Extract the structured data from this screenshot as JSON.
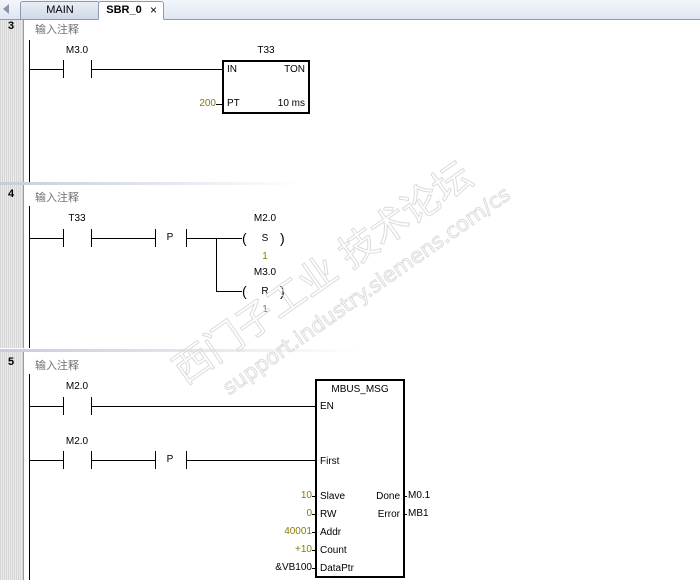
{
  "tabs": [
    {
      "label": "MAIN",
      "active": false
    },
    {
      "label": "SBR_0",
      "active": true,
      "close": "×"
    }
  ],
  "networks": [
    {
      "number": "3",
      "comment": "输入注释",
      "contact_label": "M3.0",
      "timer": {
        "name": "T33",
        "in": "IN",
        "type": "TON",
        "pt_label": "PT",
        "pt_value": "200",
        "resolution": "10 ms"
      }
    },
    {
      "number": "4",
      "comment": "输入注释",
      "contact_label": "T33",
      "edge": "P",
      "coils": [
        {
          "operand": "M2.0",
          "symbol": "S",
          "count": "1"
        },
        {
          "operand": "M3.0",
          "symbol": "R",
          "count": "1"
        }
      ]
    },
    {
      "number": "5",
      "comment": "输入注释",
      "contacts": [
        "M2.0",
        "M2.0"
      ],
      "edge": "P",
      "block": {
        "name": "MBUS_MSG",
        "en": "EN",
        "first": "First",
        "inputs": [
          {
            "param": "Slave",
            "value": "10"
          },
          {
            "param": "RW",
            "value": "0"
          },
          {
            "param": "Addr",
            "value": "40001"
          },
          {
            "param": "Count",
            "value": "+10"
          },
          {
            "param": "DataPtr",
            "value": "&VB100"
          }
        ],
        "outputs": [
          {
            "param": "Done",
            "value": "M0.1"
          },
          {
            "param": "Error",
            "value": "MB1"
          }
        ]
      }
    }
  ],
  "watermark": {
    "line1": "西门子工业  技术论坛",
    "line2": "support.industry.siemens.com/cs"
  },
  "colors": {
    "param_value": "#8a7a00",
    "tab_border": "#8a9bb5"
  }
}
